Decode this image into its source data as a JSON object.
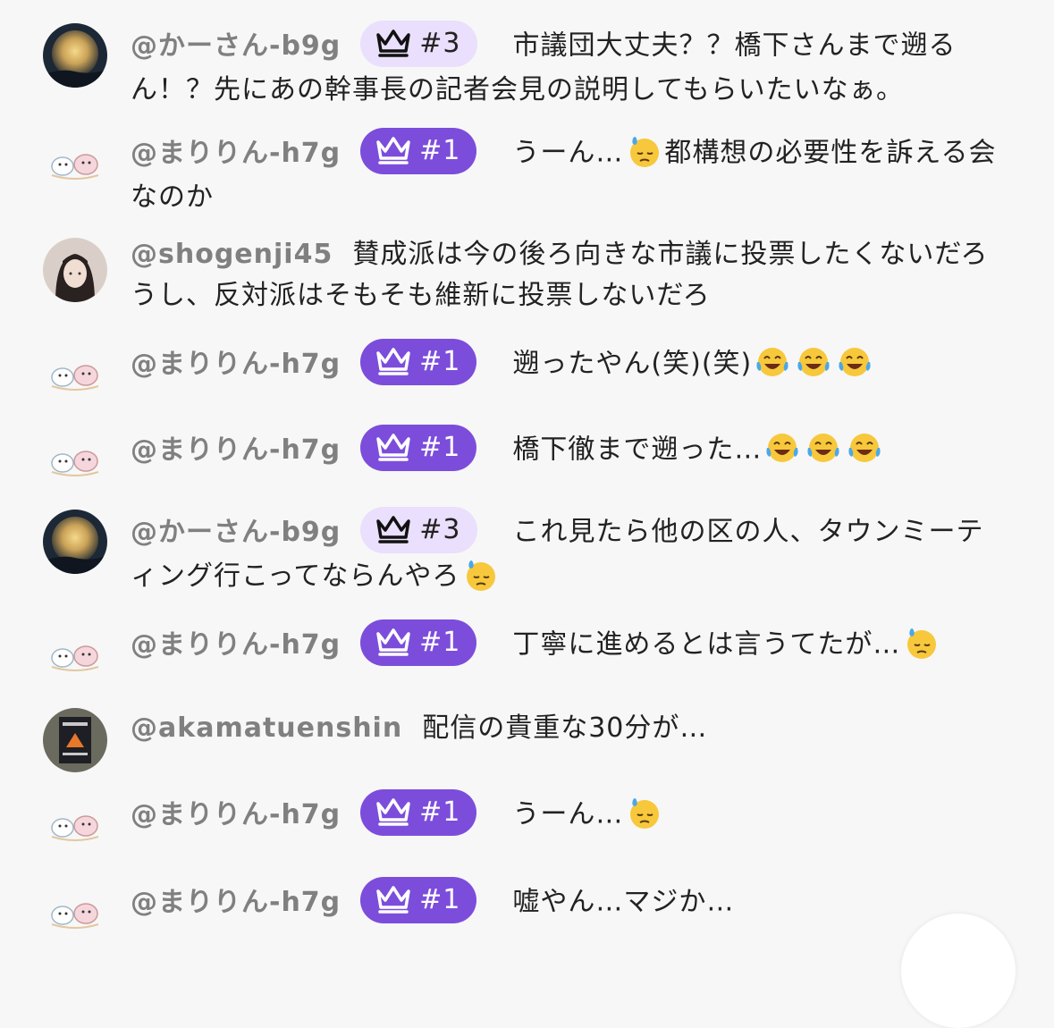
{
  "messages": [
    {
      "user": "@かーさん-b9g",
      "badge": "#3",
      "badge_style": "light",
      "avatar": "moon-avatar",
      "parts": [
        "市議団大丈夫？？橋下さんまで遡るん！？先にあの幹事長の記者会見の説明してもらいたいなぁ。"
      ]
    },
    {
      "user": "@まりりん-h7g",
      "badge": "#1",
      "badge_style": "top",
      "avatar": "illustration-avatar",
      "parts": [
        "うーん…",
        "sweat-emoji",
        "都構想の必要性を訴える会なのか"
      ]
    },
    {
      "user": "@shogenji45",
      "badge": "",
      "badge_style": "",
      "avatar": "portrait-avatar",
      "parts": [
        "賛成派は今の後ろ向きな市議に投票したくないだろうし、反対派はそもそも維新に投票しないだろ"
      ]
    },
    {
      "user": "@まりりん-h7g",
      "badge": "#1",
      "badge_style": "top",
      "avatar": "illustration-avatar",
      "parts": [
        "遡ったやん(笑)(笑)",
        "laugh-emoji",
        "laugh-emoji",
        "laugh-emoji"
      ]
    },
    {
      "user": "@まりりん-h7g",
      "badge": "#1",
      "badge_style": "top",
      "avatar": "illustration-avatar",
      "parts": [
        "橋下徹まで遡った…",
        "laugh-emoji",
        "laugh-emoji",
        "laugh-emoji"
      ]
    },
    {
      "user": "@かーさん-b9g",
      "badge": "#3",
      "badge_style": "light",
      "avatar": "moon-avatar",
      "parts": [
        "これ見たら他の区の人、タウンミーティング行こってならんやろ",
        "sweat-emoji"
      ]
    },
    {
      "user": "@まりりん-h7g",
      "badge": "#1",
      "badge_style": "top",
      "avatar": "illustration-avatar",
      "parts": [
        "丁寧に進めるとは言うてたが…",
        "sweat-emoji"
      ]
    },
    {
      "user": "@akamatuenshin",
      "badge": "",
      "badge_style": "",
      "avatar": "book-avatar",
      "parts": [
        "配信の貴重な30分が…"
      ]
    },
    {
      "user": "@まりりん-h7g",
      "badge": "#1",
      "badge_style": "top",
      "avatar": "illustration-avatar",
      "parts": [
        "うーん…",
        "sweat-emoji"
      ]
    },
    {
      "user": "@まりりん-h7g",
      "badge": "#1",
      "badge_style": "top",
      "avatar": "illustration-avatar",
      "parts": [
        "嘘やん…マジか…"
      ]
    }
  ],
  "colors": {
    "badge_top": "#7c4ddb",
    "badge_light": "#eadffc",
    "username": "#808080",
    "background": "#f7f7f7"
  }
}
